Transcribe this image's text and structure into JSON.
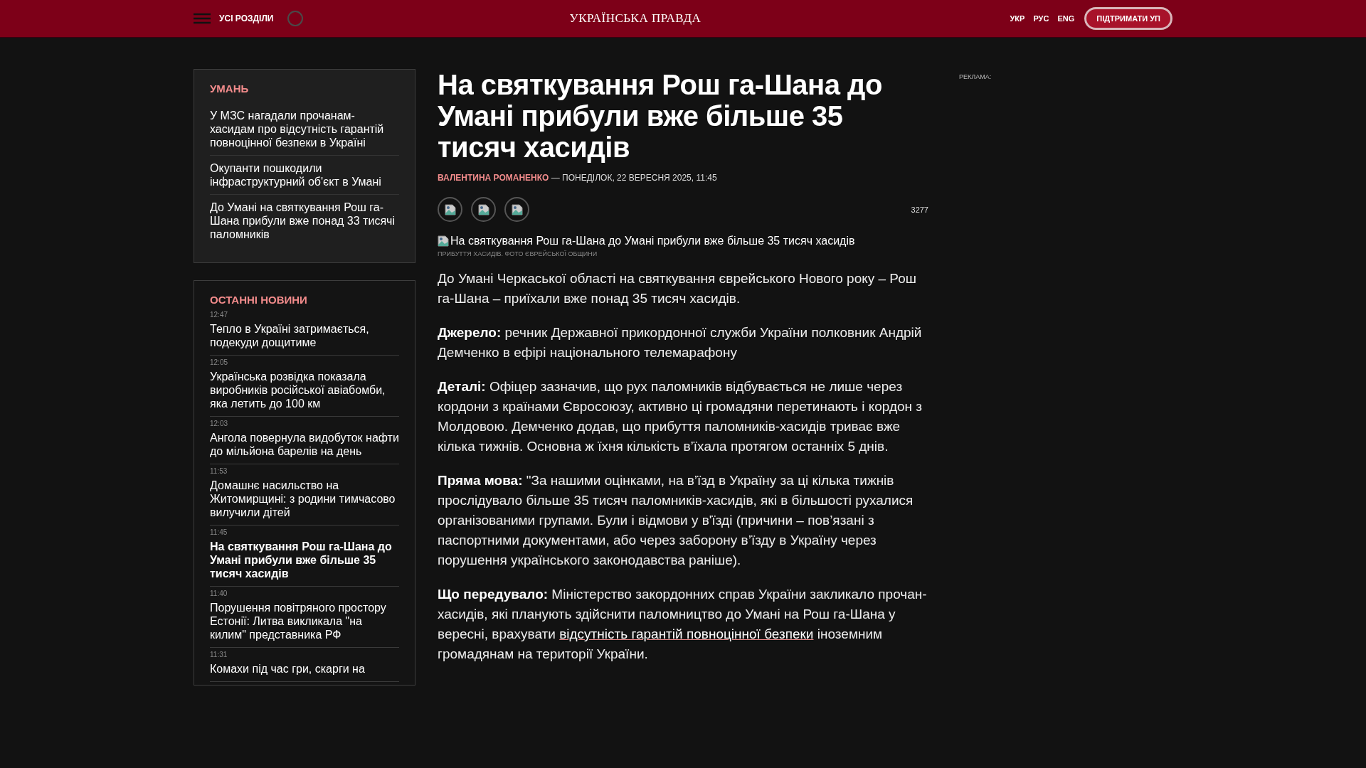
{
  "header": {
    "menu_label": "УСІ РОЗДІЛИ",
    "logo": "УКРАЇНСЬКА ПРАВДА",
    "languages": [
      {
        "label": "УКР"
      },
      {
        "label": "РУС"
      },
      {
        "label": "ENG"
      }
    ],
    "support_button": "ПІДТРИМАТИ УП"
  },
  "topic_box": {
    "title": "УМАНЬ",
    "items": [
      {
        "title": "У МЗС нагадали прочанам-хасидам про відсутність гарантій повноцінної безпеки в Україні"
      },
      {
        "title": "Окупанти пошкодили інфраструктурний об'єкт в Умані"
      },
      {
        "title": "До Умані на святкування Рош га-Шана прибули вже понад 33 тисячі паломників"
      }
    ]
  },
  "latest_news": {
    "title": "ОСТАННІ НОВИНИ",
    "items": [
      {
        "time": "12:47",
        "title": "Тепло в Україні затримається, подекуди дощитиме",
        "selected": false
      },
      {
        "time": "12:05",
        "title": "Українська розвідка показала виробників російської авіабомби, яка летить до 100 км",
        "selected": false
      },
      {
        "time": "12:03",
        "title": "Ангола повернула видобуток нафти до мільйона барелів на день",
        "selected": false
      },
      {
        "time": "11:53",
        "title": "Домашнє насильство на Житомирщині: з родини тимчасово вилучили дітей",
        "selected": false
      },
      {
        "time": "11:45",
        "title": "На святкування Рош га-Шана до Умані прибули вже більше 35 тисяч хасидів",
        "selected": true
      },
      {
        "time": "11:40",
        "title": "Порушення повітряного простору Естонії: Литва викликала \"на килим\" представника РФ",
        "selected": false
      },
      {
        "time": "11:31",
        "title": "Комахи під час гри, скарги на",
        "selected": false
      }
    ]
  },
  "article": {
    "title": "На святкування Рош га-Шана до Умані прибули вже більше 35 тисяч хасидів",
    "author": "ВАЛЕНТИНА РОМАНЕНКО",
    "date": "— ПОНЕДІЛОК, 22 ВЕРЕСНЯ 2025, 11:45",
    "views": "3277",
    "image_alt": "На святкування Рош га-Шана до Умані прибули вже більше 35 тисяч хасидів",
    "caption": "ПРИБУТТЯ ХАСИДІВ. ФОТО ЄВРЕЙСЬКОЇ ОБЩИНИ",
    "paragraphs": [
      [
        {
          "kind": "text",
          "text": "До Умані Черкаської області на святкування єврейського Нового року – Рош га-Шана – приїхали вже понад 35 тисяч хасидів."
        }
      ],
      [
        {
          "kind": "text",
          "text": "**Джерело:** речник Державної прикордонної служби України полковник Андрій Демченко в ефірі національного телемарафону"
        }
      ],
      [
        {
          "kind": "text",
          "text": "**Деталі:** Офіцер зазначив, що рух паломників відбувається не лише через кордони з країнами Євросоюзу, активно ці громадяни перетинають і кордон з Молдовою. Демченко додав, що прибуття паломників-хасидів триває вже кілька тижнів. Основна ж їхня кількість в’їхала протягом останніх 5 днів."
        }
      ],
      [
        {
          "kind": "text",
          "text": "**Пряма мова:** \"За нашими оцінками, на в’їзд в Україну за ці кілька тижнів прослідувало більше 35 тисяч паломників-хасидів, які в більшості рухалися організованими групами. Були і відмови у в'їзді (причини – пов’язані з паспортними документами, або через заборону в’їзду в Україну через порушення українського законодавства раніше)."
        }
      ],
      [
        {
          "kind": "text",
          "text": "**Що передувало:** Міністерство закордонних справ України закликало прочан-хасидів, які планують здійснити паломництво до Умані на Рош га-Шана у вересні, врахувати "
        },
        {
          "kind": "link",
          "text": "відсутність гарантій повноцінної безпеки"
        },
        {
          "kind": "text",
          "text": " іноземним громадянам на території України."
        }
      ]
    ]
  },
  "ad": {
    "label": "РЕКЛАМА:"
  }
}
